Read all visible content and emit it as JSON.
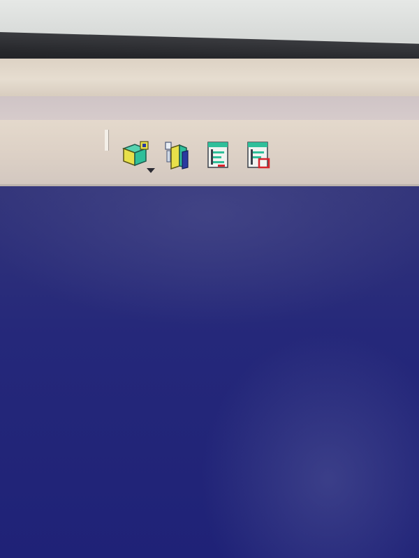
{
  "toolbar": {
    "buttons": [
      {
        "id": "product-box",
        "icon": "product-box-icon",
        "has_dropdown": true
      },
      {
        "id": "part-book",
        "icon": "part-book-icon",
        "has_dropdown": false
      },
      {
        "id": "tree-expand",
        "icon": "specification-tree-icon",
        "has_dropdown": false
      },
      {
        "id": "tree-collapse",
        "icon": "specification-tree-red-icon",
        "has_dropdown": false
      }
    ]
  },
  "colors": {
    "workspace_bg": "#25287a",
    "toolbar_bg": "#ddd1c6",
    "menu_bg": "#e6ddd0",
    "icon_green": "#2fbf9a",
    "icon_yellow": "#e8e04a",
    "icon_red": "#d8242c",
    "icon_blue": "#2a3aa0"
  }
}
